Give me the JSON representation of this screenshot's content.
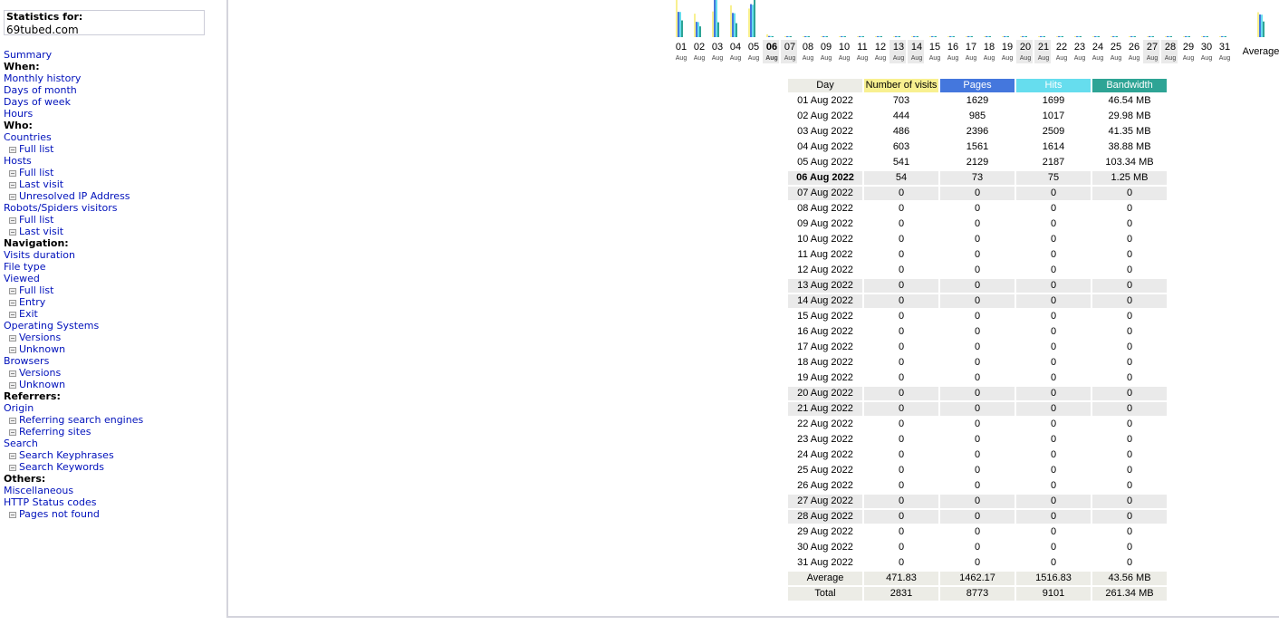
{
  "stats": {
    "label": "Statistics for:",
    "site": "69tubed.com"
  },
  "menu": [
    {
      "label": "Summary",
      "type": "link",
      "name": "menu-summary"
    },
    {
      "label": "When:",
      "type": "head",
      "name": "menu-heading-when"
    },
    {
      "label": "Monthly history",
      "type": "link",
      "name": "menu-monthly-history"
    },
    {
      "label": "Days of month",
      "type": "link",
      "name": "menu-days-of-month"
    },
    {
      "label": "Days of week",
      "type": "link",
      "name": "menu-days-of-week"
    },
    {
      "label": "Hours",
      "type": "link",
      "name": "menu-hours"
    },
    {
      "label": "Who:",
      "type": "head",
      "name": "menu-heading-who"
    },
    {
      "label": "Countries",
      "type": "link",
      "name": "menu-countries"
    },
    {
      "label": "Full list",
      "type": "sub",
      "name": "menu-countries-full-list"
    },
    {
      "label": "Hosts",
      "type": "link",
      "name": "menu-hosts"
    },
    {
      "label": "Full list",
      "type": "sub",
      "name": "menu-hosts-full-list"
    },
    {
      "label": "Last visit",
      "type": "sub",
      "name": "menu-hosts-last-visit"
    },
    {
      "label": "Unresolved IP Address",
      "type": "sub",
      "name": "menu-hosts-unresolved-ip"
    },
    {
      "label": "Robots/Spiders visitors",
      "type": "link",
      "name": "menu-robots"
    },
    {
      "label": "Full list",
      "type": "sub",
      "name": "menu-robots-full-list"
    },
    {
      "label": "Last visit",
      "type": "sub",
      "name": "menu-robots-last-visit"
    },
    {
      "label": "Navigation:",
      "type": "head",
      "name": "menu-heading-navigation"
    },
    {
      "label": "Visits duration",
      "type": "link",
      "name": "menu-visits-duration"
    },
    {
      "label": "File type",
      "type": "link",
      "name": "menu-file-type"
    },
    {
      "label": "Viewed",
      "type": "link",
      "name": "menu-viewed"
    },
    {
      "label": "Full list",
      "type": "sub",
      "name": "menu-viewed-full-list"
    },
    {
      "label": "Entry",
      "type": "sub",
      "name": "menu-viewed-entry"
    },
    {
      "label": "Exit",
      "type": "sub",
      "name": "menu-viewed-exit"
    },
    {
      "label": "Operating Systems",
      "type": "link",
      "name": "menu-operating-systems"
    },
    {
      "label": "Versions",
      "type": "sub",
      "name": "menu-os-versions"
    },
    {
      "label": "Unknown",
      "type": "sub",
      "name": "menu-os-unknown"
    },
    {
      "label": "Browsers",
      "type": "link",
      "name": "menu-browsers"
    },
    {
      "label": "Versions",
      "type": "sub",
      "name": "menu-browsers-versions"
    },
    {
      "label": "Unknown",
      "type": "sub",
      "name": "menu-browsers-unknown"
    },
    {
      "label": "Referrers:",
      "type": "head",
      "name": "menu-heading-referrers"
    },
    {
      "label": "Origin",
      "type": "link",
      "name": "menu-origin"
    },
    {
      "label": "Referring search engines",
      "type": "sub",
      "name": "menu-referring-search-engines"
    },
    {
      "label": "Referring sites",
      "type": "sub",
      "name": "menu-referring-sites"
    },
    {
      "label": "Search",
      "type": "link",
      "name": "menu-search"
    },
    {
      "label": "Search Keyphrases",
      "type": "sub",
      "name": "menu-search-keyphrases"
    },
    {
      "label": "Search Keywords",
      "type": "sub",
      "name": "menu-search-keywords"
    },
    {
      "label": "Others:",
      "type": "head",
      "name": "menu-heading-others"
    },
    {
      "label": "Miscellaneous",
      "type": "link",
      "name": "menu-miscellaneous"
    },
    {
      "label": "HTTP Status codes",
      "type": "link",
      "name": "menu-http-status-codes"
    },
    {
      "label": "Pages not found",
      "type": "sub",
      "name": "menu-pages-not-found"
    }
  ],
  "table": {
    "headers": {
      "day": "Day",
      "visits": "Number of visits",
      "pages": "Pages",
      "hits": "Hits",
      "bandwidth": "Bandwidth"
    },
    "rows": [
      {
        "day": "01 Aug 2022",
        "visits": "703",
        "pages": "1629",
        "hits": "1699",
        "bw": "46.54 MB",
        "weekend": false
      },
      {
        "day": "02 Aug 2022",
        "visits": "444",
        "pages": "985",
        "hits": "1017",
        "bw": "29.98 MB",
        "weekend": false
      },
      {
        "day": "03 Aug 2022",
        "visits": "486",
        "pages": "2396",
        "hits": "2509",
        "bw": "41.35 MB",
        "weekend": false
      },
      {
        "day": "04 Aug 2022",
        "visits": "603",
        "pages": "1561",
        "hits": "1614",
        "bw": "38.88 MB",
        "weekend": false
      },
      {
        "day": "05 Aug 2022",
        "visits": "541",
        "pages": "2129",
        "hits": "2187",
        "bw": "103.34 MB",
        "weekend": false
      },
      {
        "day": "06 Aug 2022",
        "visits": "54",
        "pages": "73",
        "hits": "75",
        "bw": "1.25 MB",
        "weekend": true,
        "current": true
      },
      {
        "day": "07 Aug 2022",
        "visits": "0",
        "pages": "0",
        "hits": "0",
        "bw": "0",
        "weekend": true
      },
      {
        "day": "08 Aug 2022",
        "visits": "0",
        "pages": "0",
        "hits": "0",
        "bw": "0",
        "weekend": false
      },
      {
        "day": "09 Aug 2022",
        "visits": "0",
        "pages": "0",
        "hits": "0",
        "bw": "0",
        "weekend": false
      },
      {
        "day": "10 Aug 2022",
        "visits": "0",
        "pages": "0",
        "hits": "0",
        "bw": "0",
        "weekend": false
      },
      {
        "day": "11 Aug 2022",
        "visits": "0",
        "pages": "0",
        "hits": "0",
        "bw": "0",
        "weekend": false
      },
      {
        "day": "12 Aug 2022",
        "visits": "0",
        "pages": "0",
        "hits": "0",
        "bw": "0",
        "weekend": false
      },
      {
        "day": "13 Aug 2022",
        "visits": "0",
        "pages": "0",
        "hits": "0",
        "bw": "0",
        "weekend": true
      },
      {
        "day": "14 Aug 2022",
        "visits": "0",
        "pages": "0",
        "hits": "0",
        "bw": "0",
        "weekend": true
      },
      {
        "day": "15 Aug 2022",
        "visits": "0",
        "pages": "0",
        "hits": "0",
        "bw": "0",
        "weekend": false
      },
      {
        "day": "16 Aug 2022",
        "visits": "0",
        "pages": "0",
        "hits": "0",
        "bw": "0",
        "weekend": false
      },
      {
        "day": "17 Aug 2022",
        "visits": "0",
        "pages": "0",
        "hits": "0",
        "bw": "0",
        "weekend": false
      },
      {
        "day": "18 Aug 2022",
        "visits": "0",
        "pages": "0",
        "hits": "0",
        "bw": "0",
        "weekend": false
      },
      {
        "day": "19 Aug 2022",
        "visits": "0",
        "pages": "0",
        "hits": "0",
        "bw": "0",
        "weekend": false
      },
      {
        "day": "20 Aug 2022",
        "visits": "0",
        "pages": "0",
        "hits": "0",
        "bw": "0",
        "weekend": true
      },
      {
        "day": "21 Aug 2022",
        "visits": "0",
        "pages": "0",
        "hits": "0",
        "bw": "0",
        "weekend": true
      },
      {
        "day": "22 Aug 2022",
        "visits": "0",
        "pages": "0",
        "hits": "0",
        "bw": "0",
        "weekend": false
      },
      {
        "day": "23 Aug 2022",
        "visits": "0",
        "pages": "0",
        "hits": "0",
        "bw": "0",
        "weekend": false
      },
      {
        "day": "24 Aug 2022",
        "visits": "0",
        "pages": "0",
        "hits": "0",
        "bw": "0",
        "weekend": false
      },
      {
        "day": "25 Aug 2022",
        "visits": "0",
        "pages": "0",
        "hits": "0",
        "bw": "0",
        "weekend": false
      },
      {
        "day": "26 Aug 2022",
        "visits": "0",
        "pages": "0",
        "hits": "0",
        "bw": "0",
        "weekend": false
      },
      {
        "day": "27 Aug 2022",
        "visits": "0",
        "pages": "0",
        "hits": "0",
        "bw": "0",
        "weekend": true
      },
      {
        "day": "28 Aug 2022",
        "visits": "0",
        "pages": "0",
        "hits": "0",
        "bw": "0",
        "weekend": true
      },
      {
        "day": "29 Aug 2022",
        "visits": "0",
        "pages": "0",
        "hits": "0",
        "bw": "0",
        "weekend": false
      },
      {
        "day": "30 Aug 2022",
        "visits": "0",
        "pages": "0",
        "hits": "0",
        "bw": "0",
        "weekend": false
      },
      {
        "day": "31 Aug 2022",
        "visits": "0",
        "pages": "0",
        "hits": "0",
        "bw": "0",
        "weekend": false
      }
    ],
    "average": {
      "day": "Average",
      "visits": "471.83",
      "pages": "1462.17",
      "hits": "1516.83",
      "bw": "43.56 MB"
    },
    "total": {
      "day": "Total",
      "visits": "2831",
      "pages": "8773",
      "hits": "9101",
      "bw": "261.34 MB"
    }
  },
  "chart_data": {
    "type": "bar",
    "categories": [
      "01",
      "02",
      "03",
      "04",
      "05",
      "06",
      "07",
      "08",
      "09",
      "10",
      "11",
      "12",
      "13",
      "14",
      "15",
      "16",
      "17",
      "18",
      "19",
      "20",
      "21",
      "22",
      "23",
      "24",
      "25",
      "26",
      "27",
      "28",
      "29",
      "30",
      "31"
    ],
    "month_label": "Aug",
    "weekend_days": [
      "06",
      "07",
      "13",
      "14",
      "20",
      "21",
      "27",
      "28"
    ],
    "current_day": "06",
    "average_label": "Average",
    "series": [
      {
        "name": "Number of visits",
        "color": "#f8f090",
        "values": [
          703,
          444,
          486,
          603,
          541,
          54,
          0,
          0,
          0,
          0,
          0,
          0,
          0,
          0,
          0,
          0,
          0,
          0,
          0,
          0,
          0,
          0,
          0,
          0,
          0,
          0,
          0,
          0,
          0,
          0,
          0
        ],
        "average": 471.83
      },
      {
        "name": "Pages",
        "color": "#4477dd",
        "values": [
          1629,
          985,
          2396,
          1561,
          2129,
          73,
          0,
          0,
          0,
          0,
          0,
          0,
          0,
          0,
          0,
          0,
          0,
          0,
          0,
          0,
          0,
          0,
          0,
          0,
          0,
          0,
          0,
          0,
          0,
          0,
          0
        ],
        "average": 1462.17
      },
      {
        "name": "Hits",
        "color": "#66ddee",
        "values": [
          1699,
          1017,
          2509,
          1614,
          2187,
          75,
          0,
          0,
          0,
          0,
          0,
          0,
          0,
          0,
          0,
          0,
          0,
          0,
          0,
          0,
          0,
          0,
          0,
          0,
          0,
          0,
          0,
          0,
          0,
          0,
          0
        ],
        "average": 1516.83
      },
      {
        "name": "Bandwidth",
        "color": "#2ea495",
        "values": [
          46.54,
          29.98,
          41.35,
          38.88,
          103.34,
          1.25,
          0,
          0,
          0,
          0,
          0,
          0,
          0,
          0,
          0,
          0,
          0,
          0,
          0,
          0,
          0,
          0,
          0,
          0,
          0,
          0,
          0,
          0,
          0,
          0,
          0
        ],
        "average": 43.56
      }
    ]
  }
}
